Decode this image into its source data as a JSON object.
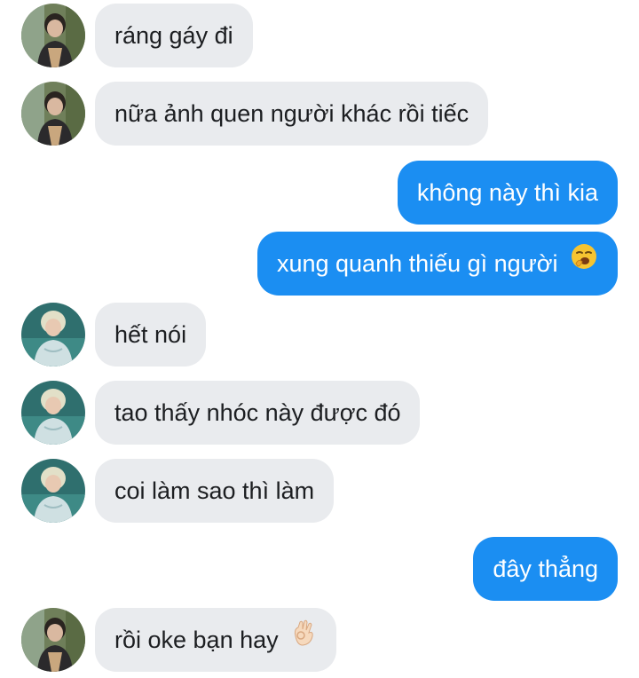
{
  "conversation": {
    "messages": [
      {
        "direction": "incoming",
        "sender": "contact-a",
        "text": "ráng gáy đi"
      },
      {
        "direction": "incoming",
        "sender": "contact-a",
        "text": "nữa ảnh quen người khác rồi tiếc"
      },
      {
        "direction": "outgoing",
        "text": "không này thì kia"
      },
      {
        "direction": "outgoing",
        "text": "xung quanh thiếu gì người",
        "emoji": "yawning-face-emoji"
      },
      {
        "direction": "incoming",
        "sender": "contact-b",
        "text": "hết nói"
      },
      {
        "direction": "incoming",
        "sender": "contact-b",
        "text": "tao thấy nhóc này được đó"
      },
      {
        "direction": "incoming",
        "sender": "contact-b",
        "text": "coi làm sao thì làm"
      },
      {
        "direction": "outgoing",
        "text": "đây thẳng"
      },
      {
        "direction": "incoming",
        "sender": "contact-a",
        "text": "rồi oke bạn hay",
        "emoji": "ok-hand-emoji"
      }
    ]
  },
  "colors": {
    "incoming_bubble": "#e9ebee",
    "outgoing_bubble": "#1b8ef2",
    "incoming_text": "#1c1e21",
    "outgoing_text": "#ffffff"
  }
}
